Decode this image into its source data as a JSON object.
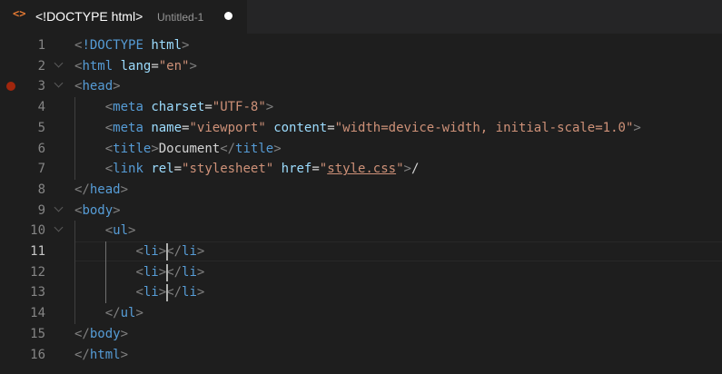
{
  "tab": {
    "icon": "html-file-icon",
    "icon_glyph": "<>",
    "title": "<!DOCTYPE html>",
    "description": "Untitled-1",
    "dirty_indicator": "unsaved-dot"
  },
  "editor": {
    "current_line": 11,
    "breakpoint_line": 3,
    "lines": [
      {
        "n": "1",
        "tokens": [
          [
            "t-punc",
            "<"
          ],
          [
            "t-tag",
            "!DOCTYPE"
          ],
          [
            "t-text",
            " "
          ],
          [
            "t-attr",
            "html"
          ],
          [
            "t-punc",
            ">"
          ]
        ]
      },
      {
        "n": "2",
        "tokens": [
          [
            "t-punc",
            "<"
          ],
          [
            "t-tag",
            "html"
          ],
          [
            "t-text",
            " "
          ],
          [
            "t-attr",
            "lang"
          ],
          [
            "t-text",
            "="
          ],
          [
            "t-str",
            "\"en\""
          ],
          [
            "t-punc",
            ">"
          ]
        ]
      },
      {
        "n": "3",
        "tokens": [
          [
            "t-punc",
            "<"
          ],
          [
            "t-tag",
            "head"
          ],
          [
            "t-punc",
            ">"
          ]
        ]
      },
      {
        "n": "4",
        "tokens": [
          [
            "t-text",
            "    "
          ],
          [
            "t-punc",
            "<"
          ],
          [
            "t-tag",
            "meta"
          ],
          [
            "t-text",
            " "
          ],
          [
            "t-attr",
            "charset"
          ],
          [
            "t-text",
            "="
          ],
          [
            "t-str",
            "\"UTF-8\""
          ],
          [
            "t-punc",
            ">"
          ]
        ]
      },
      {
        "n": "5",
        "tokens": [
          [
            "t-text",
            "    "
          ],
          [
            "t-punc",
            "<"
          ],
          [
            "t-tag",
            "meta"
          ],
          [
            "t-text",
            " "
          ],
          [
            "t-attr",
            "name"
          ],
          [
            "t-text",
            "="
          ],
          [
            "t-str",
            "\"viewport\""
          ],
          [
            "t-text",
            " "
          ],
          [
            "t-attr",
            "content"
          ],
          [
            "t-text",
            "="
          ],
          [
            "t-str",
            "\"width=device-width, initial-scale=1.0\""
          ],
          [
            "t-punc",
            ">"
          ]
        ]
      },
      {
        "n": "6",
        "tokens": [
          [
            "t-text",
            "    "
          ],
          [
            "t-punc",
            "<"
          ],
          [
            "t-tag",
            "title"
          ],
          [
            "t-punc",
            ">"
          ],
          [
            "t-text",
            "Document"
          ],
          [
            "t-punc",
            "</"
          ],
          [
            "t-tag",
            "title"
          ],
          [
            "t-punc",
            ">"
          ]
        ]
      },
      {
        "n": "7",
        "tokens": [
          [
            "t-text",
            "    "
          ],
          [
            "t-punc",
            "<"
          ],
          [
            "t-tag",
            "link"
          ],
          [
            "t-text",
            " "
          ],
          [
            "t-attr",
            "rel"
          ],
          [
            "t-text",
            "="
          ],
          [
            "t-str",
            "\"stylesheet\""
          ],
          [
            "t-text",
            " "
          ],
          [
            "t-attr",
            "href"
          ],
          [
            "t-text",
            "="
          ],
          [
            "t-str",
            "\""
          ],
          [
            "t-str t-link",
            "style.css"
          ],
          [
            "t-str",
            "\""
          ],
          [
            "t-punc",
            ">"
          ],
          [
            "t-text",
            "/"
          ]
        ]
      },
      {
        "n": "8",
        "tokens": [
          [
            "t-punc",
            "</"
          ],
          [
            "t-tag",
            "head"
          ],
          [
            "t-punc",
            ">"
          ]
        ]
      },
      {
        "n": "9",
        "tokens": [
          [
            "t-punc",
            "<"
          ],
          [
            "t-tag",
            "body"
          ],
          [
            "t-punc",
            ">"
          ]
        ]
      },
      {
        "n": "10",
        "tokens": [
          [
            "t-text",
            "    "
          ],
          [
            "t-punc",
            "<"
          ],
          [
            "t-tag",
            "ul"
          ],
          [
            "t-punc",
            ">"
          ]
        ]
      },
      {
        "n": "11",
        "tokens": [
          [
            "t-text",
            "        "
          ],
          [
            "t-punc",
            "<"
          ],
          [
            "t-tag",
            "li"
          ],
          [
            "t-punc",
            ">"
          ],
          [
            "t-punc",
            "</"
          ],
          [
            "t-tag",
            "li"
          ],
          [
            "t-punc",
            ">"
          ]
        ]
      },
      {
        "n": "12",
        "tokens": [
          [
            "t-text",
            "        "
          ],
          [
            "t-punc",
            "<"
          ],
          [
            "t-tag",
            "li"
          ],
          [
            "t-punc",
            ">"
          ],
          [
            "t-punc",
            "</"
          ],
          [
            "t-tag",
            "li"
          ],
          [
            "t-punc",
            ">"
          ]
        ]
      },
      {
        "n": "13",
        "tokens": [
          [
            "t-text",
            "        "
          ],
          [
            "t-punc",
            "<"
          ],
          [
            "t-tag",
            "li"
          ],
          [
            "t-punc",
            ">"
          ],
          [
            "t-punc",
            "</"
          ],
          [
            "t-tag",
            "li"
          ],
          [
            "t-punc",
            ">"
          ]
        ]
      },
      {
        "n": "14",
        "tokens": [
          [
            "t-text",
            "    "
          ],
          [
            "t-punc",
            "</"
          ],
          [
            "t-tag",
            "ul"
          ],
          [
            "t-punc",
            ">"
          ]
        ]
      },
      {
        "n": "15",
        "tokens": [
          [
            "t-punc",
            "</"
          ],
          [
            "t-tag",
            "body"
          ],
          [
            "t-punc",
            ">"
          ]
        ]
      },
      {
        "n": "16",
        "tokens": [
          [
            "t-punc",
            "</"
          ],
          [
            "t-tag",
            "html"
          ],
          [
            "t-punc",
            ">"
          ]
        ]
      }
    ]
  }
}
